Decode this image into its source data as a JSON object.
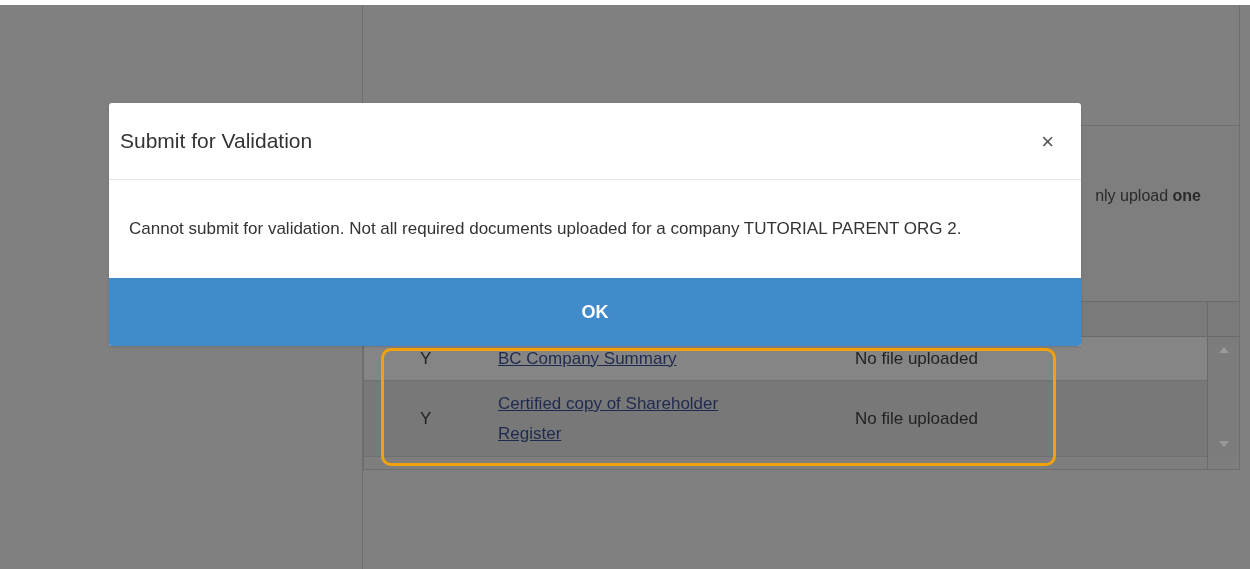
{
  "background": {
    "note": {
      "text": "nly upload **one**"
    },
    "table": {
      "rows": [
        {
          "required": "Y",
          "document": "BC Company Summary",
          "status": "No file uploaded"
        },
        {
          "required": "Y",
          "document": "Certified copy of Shareholder Register",
          "status": "No file uploaded"
        }
      ]
    }
  },
  "dialog": {
    "title": "Submit for Validation",
    "close": "×",
    "message": "Cannot submit for validation. Not all required documents uploaded for a company TUTORIAL PARENT ORG 2.",
    "button": "OK"
  }
}
